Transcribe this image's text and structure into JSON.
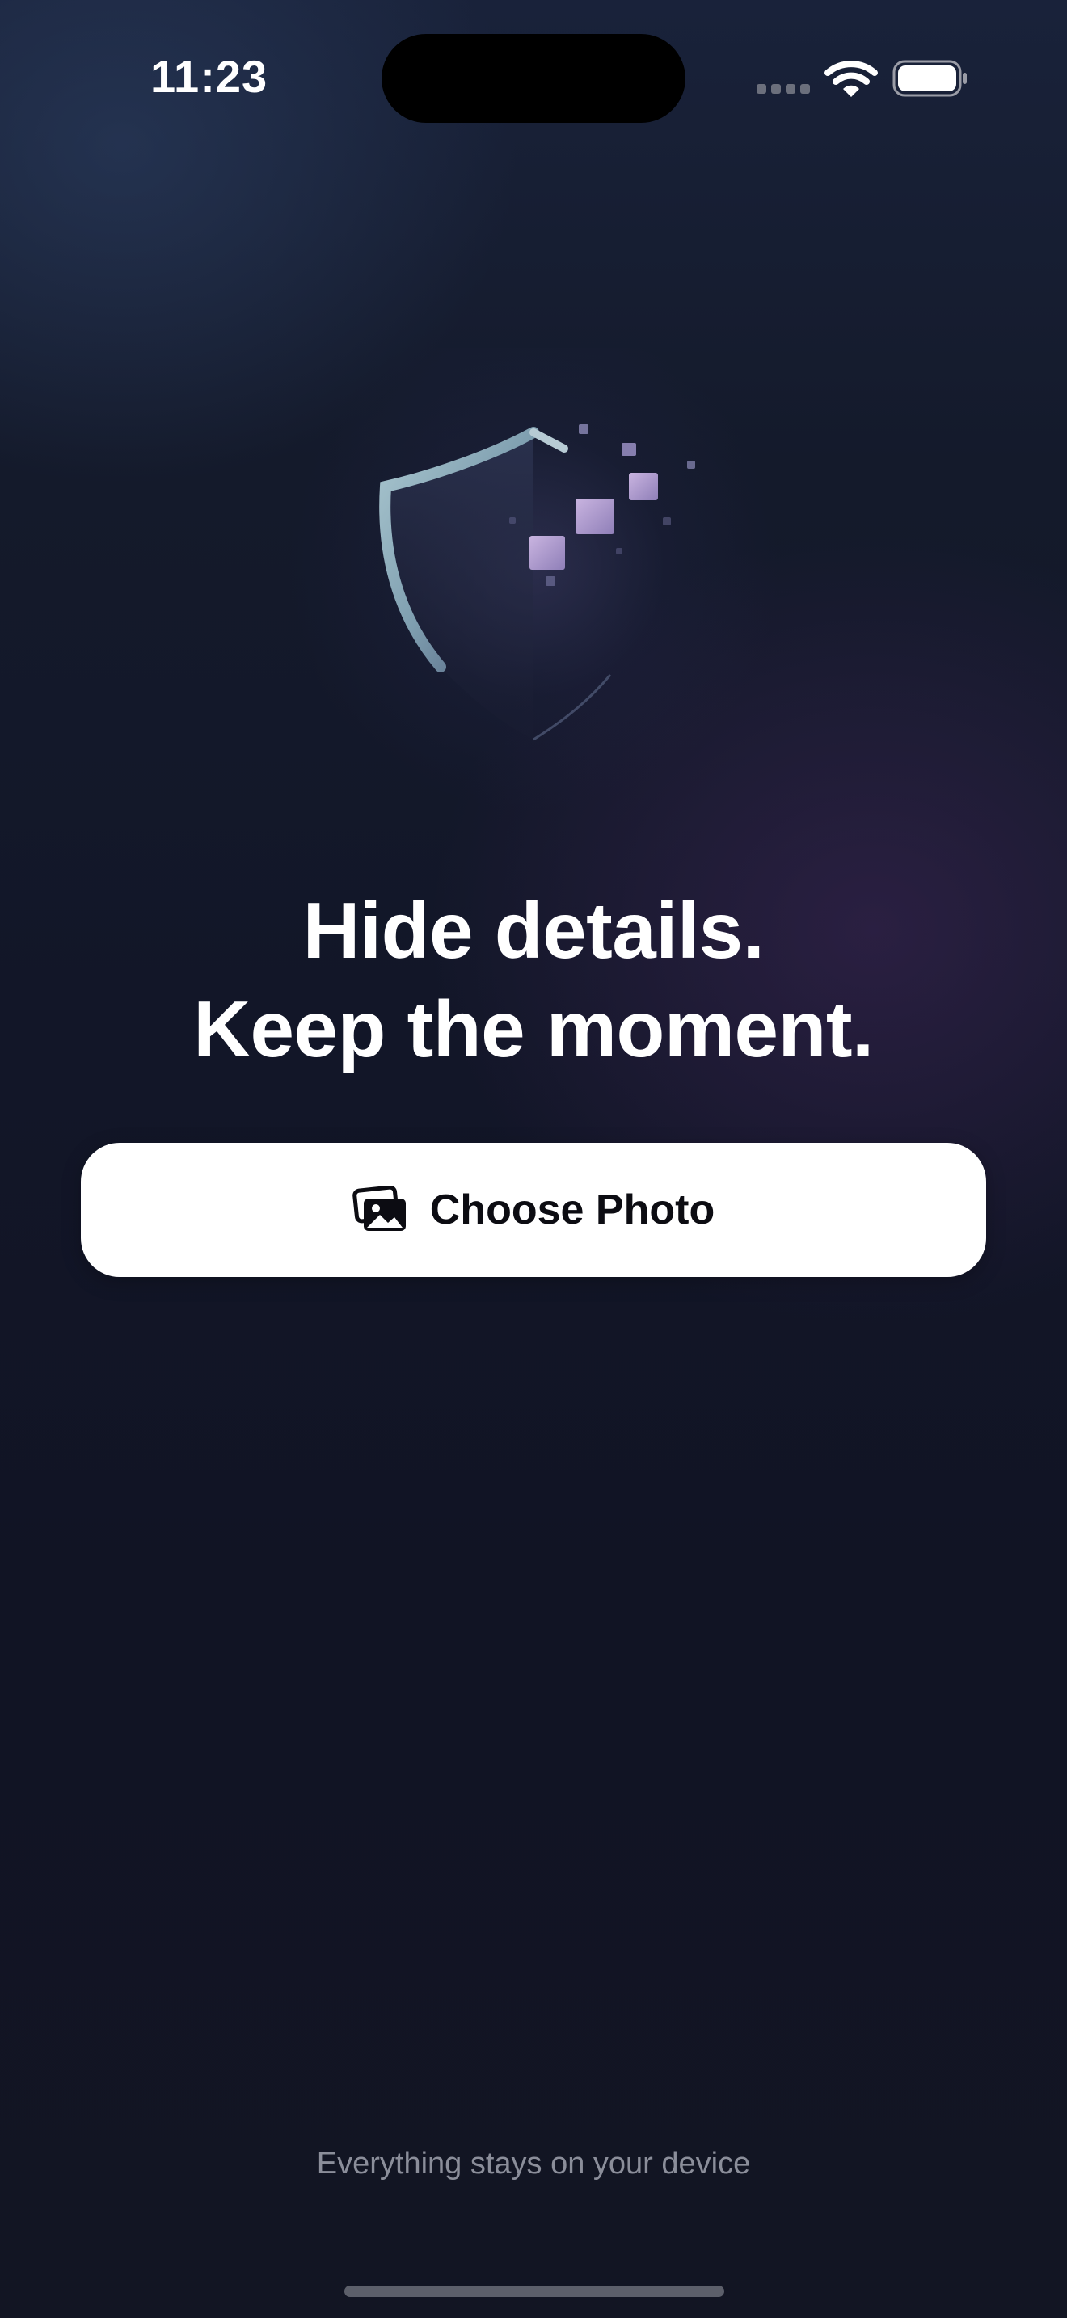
{
  "status_bar": {
    "time": "11:23",
    "icons": [
      "cellular-signal-icon",
      "wifi-icon",
      "battery-icon"
    ]
  },
  "hero": {
    "icon": "shield-pixelate-icon",
    "headline_line1": "Hide details.",
    "headline_line2": "Keep the moment."
  },
  "primary_action": {
    "icon": "photo-stack-icon",
    "label": "Choose Photo"
  },
  "footer": {
    "note": "Everything stays on your device"
  },
  "colors": {
    "background_top": "#19223a",
    "background_bottom": "#121523",
    "button_background": "#ffffff",
    "button_text": "#0c0c12",
    "footer_text": "#8b8e9a"
  }
}
